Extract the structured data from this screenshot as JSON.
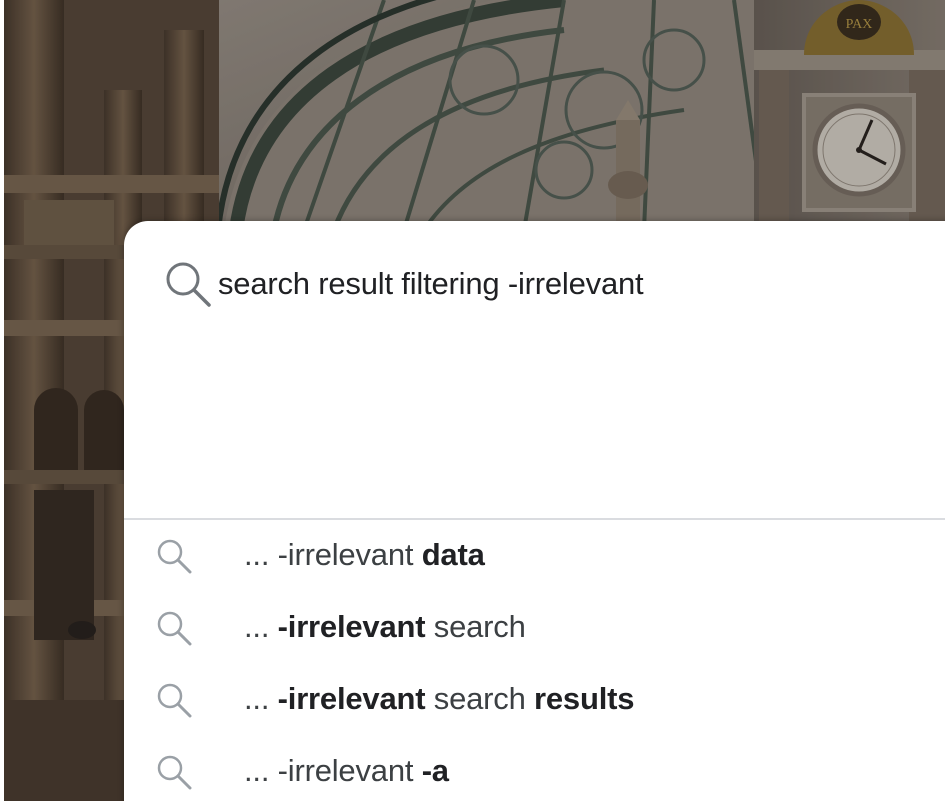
{
  "search": {
    "query": "search result filtering -irrelevant",
    "icon": "search-icon"
  },
  "suggestions": [
    {
      "icon": "search-icon",
      "parts": [
        {
          "text": "... -irrelevant ",
          "bold": false
        },
        {
          "text": "data",
          "bold": true
        }
      ]
    },
    {
      "icon": "search-icon",
      "parts": [
        {
          "text": "... ",
          "bold": false
        },
        {
          "text": "-irrelevant",
          "bold": true
        },
        {
          "text": " search",
          "bold": false
        }
      ]
    },
    {
      "icon": "search-icon",
      "parts": [
        {
          "text": "... ",
          "bold": false
        },
        {
          "text": "-irrelevant",
          "bold": true
        },
        {
          "text": " search ",
          "bold": false
        },
        {
          "text": "results",
          "bold": true
        }
      ]
    },
    {
      "icon": "search-icon",
      "parts": [
        {
          "text": "... -irrelevant ",
          "bold": false
        },
        {
          "text": "-a",
          "bold": true
        }
      ]
    }
  ],
  "background": {
    "clock_label": "PAX"
  },
  "colors": {
    "panel": "#ffffff",
    "text_primary": "#202124",
    "text_secondary": "#3c4043",
    "divider": "#dadce0",
    "icon": "#9aa0a6"
  }
}
